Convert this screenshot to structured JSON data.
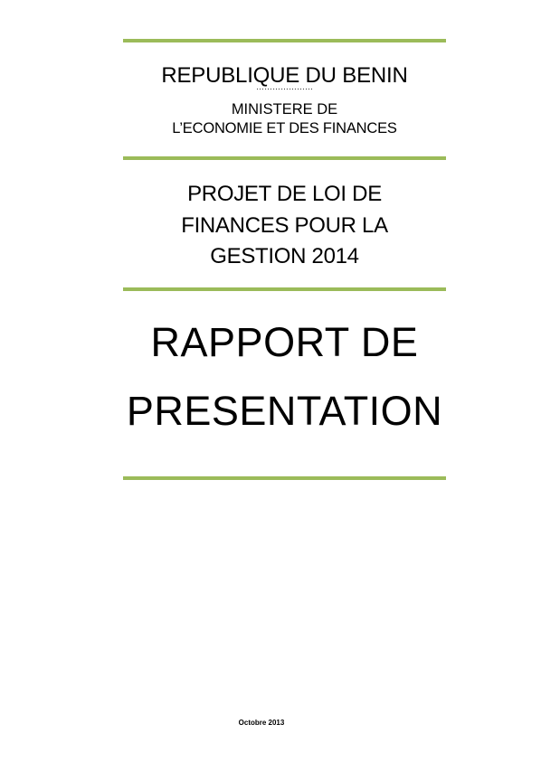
{
  "header": {
    "country": "REPUBLIQUE DU BENIN",
    "separator": "…………………",
    "ministry_line1": "MINISTERE DE",
    "ministry_line2": "L’ECONOMIE ET DES FINANCES"
  },
  "project": {
    "line1": "PROJET DE LOI DE",
    "line2": "FINANCES POUR LA",
    "line3": "GESTION 2014"
  },
  "title": {
    "line1": "RAPPORT DE",
    "line2": "PRESENTATION"
  },
  "footer": {
    "date": "Octobre 2013"
  },
  "colors": {
    "rule": "#9bbb59",
    "text": "#000000"
  }
}
